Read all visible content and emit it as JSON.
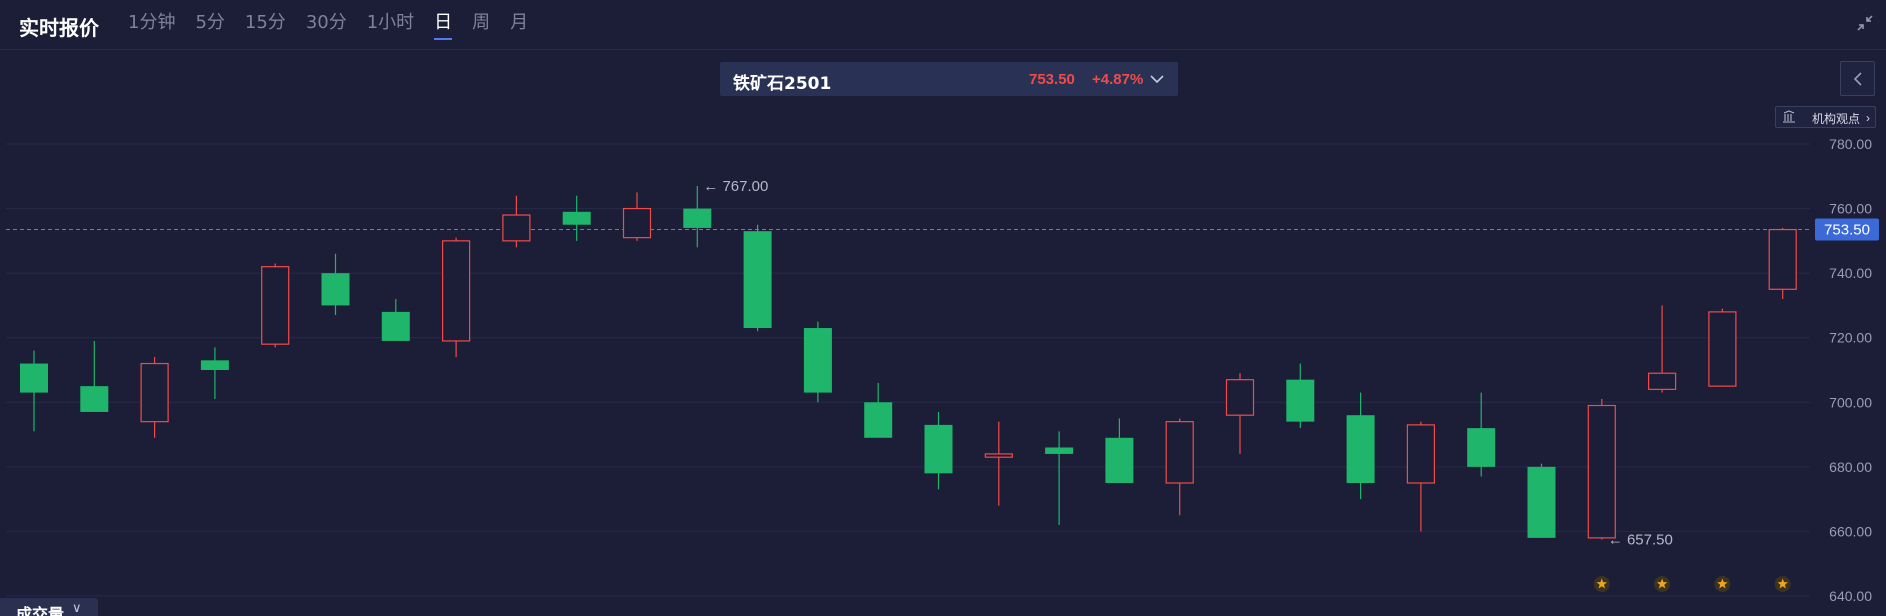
{
  "header": {
    "title": "实时报价",
    "tabs": [
      {
        "label": "1分钟",
        "active": false
      },
      {
        "label": "5分",
        "active": false
      },
      {
        "label": "15分",
        "active": false
      },
      {
        "label": "30分",
        "active": false
      },
      {
        "label": "1小时",
        "active": false
      },
      {
        "label": "日",
        "active": true
      },
      {
        "label": "周",
        "active": false
      },
      {
        "label": "月",
        "active": false
      }
    ],
    "collapse_icon": "collapse-arrows-icon"
  },
  "symbol": {
    "name": "铁矿石2501",
    "price": "753.50",
    "change": "+4.87%",
    "chevron_icon": "chevron-down-icon"
  },
  "side_button_icon": "chevron-left-icon",
  "view_button": {
    "label": "机构观点",
    "chevron": "›",
    "icon": "institution-icon"
  },
  "volume_tab": {
    "label": "成交量",
    "chevron": "∨"
  },
  "colors": {
    "up": "#f04b4b",
    "down": "#1fb56a",
    "accent": "#4e7cf2",
    "background": "#1b1e36"
  },
  "chart_data": {
    "type": "candlestick",
    "ylim": [
      640,
      780
    ],
    "yticks": [
      "780.00",
      "760.00",
      "740.00",
      "720.00",
      "700.00",
      "680.00",
      "660.00",
      "640.00"
    ],
    "current_price": 753.5,
    "current_price_label": "753.50",
    "annotations": [
      {
        "text": "← 767.00",
        "candle_index": 11
      },
      {
        "text": "← 657.50",
        "candle_index": 26
      }
    ],
    "candles": [
      {
        "o": 712,
        "h": 716,
        "l": 691,
        "c": 703
      },
      {
        "o": 705,
        "h": 719,
        "l": 697,
        "c": 697
      },
      {
        "o": 694,
        "h": 714,
        "l": 689,
        "c": 712
      },
      {
        "o": 713,
        "h": 717,
        "l": 701,
        "c": 710
      },
      {
        "o": 718,
        "h": 743,
        "l": 717,
        "c": 742
      },
      {
        "o": 740,
        "h": 746,
        "l": 727,
        "c": 730
      },
      {
        "o": 728,
        "h": 732,
        "l": 719,
        "c": 719
      },
      {
        "o": 719,
        "h": 751,
        "l": 714,
        "c": 750
      },
      {
        "o": 750,
        "h": 764,
        "l": 748,
        "c": 758
      },
      {
        "o": 759,
        "h": 764,
        "l": 750,
        "c": 755
      },
      {
        "o": 751,
        "h": 765,
        "l": 750,
        "c": 760
      },
      {
        "o": 760,
        "h": 767,
        "l": 748,
        "c": 754
      },
      {
        "o": 753,
        "h": 755,
        "l": 722,
        "c": 723
      },
      {
        "o": 723,
        "h": 725,
        "l": 700,
        "c": 703
      },
      {
        "o": 700,
        "h": 706,
        "l": 689,
        "c": 689
      },
      {
        "o": 693,
        "h": 697,
        "l": 673,
        "c": 678
      },
      {
        "o": 683,
        "h": 694,
        "l": 668,
        "c": 684
      },
      {
        "o": 686,
        "h": 691,
        "l": 662,
        "c": 684
      },
      {
        "o": 689,
        "h": 695,
        "l": 675,
        "c": 675
      },
      {
        "o": 675,
        "h": 695,
        "l": 665,
        "c": 694
      },
      {
        "o": 696,
        "h": 709,
        "l": 684,
        "c": 707
      },
      {
        "o": 707,
        "h": 712,
        "l": 692,
        "c": 694
      },
      {
        "o": 696,
        "h": 703,
        "l": 670,
        "c": 675
      },
      {
        "o": 675,
        "h": 694,
        "l": 660,
        "c": 693
      },
      {
        "o": 692,
        "h": 703,
        "l": 677,
        "c": 680
      },
      {
        "o": 680,
        "h": 681,
        "l": 658,
        "c": 658
      },
      {
        "o": 658,
        "h": 701,
        "l": 657.5,
        "c": 699
      },
      {
        "o": 704,
        "h": 730,
        "l": 703,
        "c": 709
      },
      {
        "o": 705,
        "h": 729,
        "l": 705,
        "c": 728
      },
      {
        "o": 735,
        "h": 754,
        "l": 732,
        "c": 753.5
      }
    ],
    "event_markers": [
      26,
      27,
      28,
      29
    ],
    "event_icon": "star-badge-icon"
  }
}
